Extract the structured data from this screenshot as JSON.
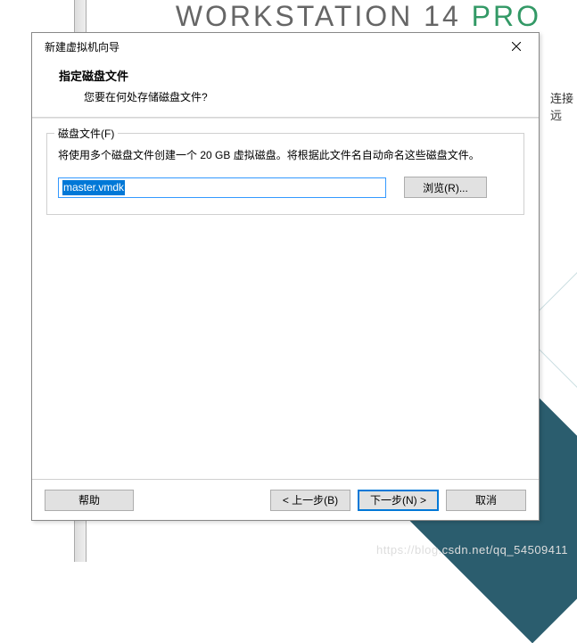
{
  "background": {
    "product_name": "WORKSTATION 14",
    "product_suffix": "PRO",
    "side_text": "连接远",
    "watermark": "https://blog.csdn.net/qq_54509411"
  },
  "dialog": {
    "title": "新建虚拟机向导",
    "header": {
      "title": "指定磁盘文件",
      "subtitle": "您要在何处存储磁盘文件?"
    },
    "fieldset": {
      "legend": "磁盘文件(F)",
      "description": "将使用多个磁盘文件创建一个 20 GB 虚拟磁盘。将根据此文件名自动命名这些磁盘文件。",
      "file_value": "master.vmdk",
      "browse_label": "浏览(R)..."
    },
    "footer": {
      "help_label": "帮助",
      "back_label": "< 上一步(B)",
      "next_label": "下一步(N) >",
      "cancel_label": "取消"
    }
  }
}
